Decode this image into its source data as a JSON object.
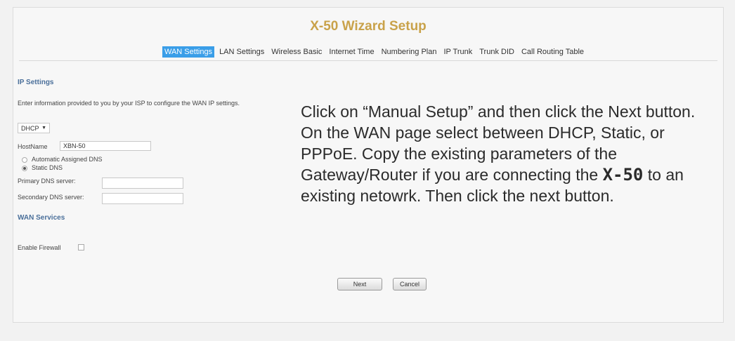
{
  "header": {
    "title": "X-50 Wizard Setup"
  },
  "tabs": [
    {
      "label": "WAN Settings",
      "active": true
    },
    {
      "label": "LAN Settings",
      "active": false
    },
    {
      "label": "Wireless Basic",
      "active": false
    },
    {
      "label": "Internet Time",
      "active": false
    },
    {
      "label": "Numbering Plan",
      "active": false
    },
    {
      "label": "IP Trunk",
      "active": false
    },
    {
      "label": "Trunk DID",
      "active": false
    },
    {
      "label": "Call Routing Table",
      "active": false
    }
  ],
  "ip_settings": {
    "title": "IP Settings",
    "description": "Enter information provided to you by your ISP to configure the WAN IP settings.",
    "mode": "DHCP",
    "hostname_label": "HostName",
    "hostname_value": "XBN-50",
    "dns_auto_label": "Automatic Assigned DNS",
    "dns_static_label": "Static DNS",
    "primary_dns_label": "Primary DNS server:",
    "primary_dns_value": "",
    "secondary_dns_label": "Secondary DNS server:",
    "secondary_dns_value": ""
  },
  "wan_services": {
    "title": "WAN Services",
    "firewall_label": "Enable Firewall",
    "firewall_checked": false
  },
  "instructions": {
    "part1": "Click on “Manual Setup” and then click the Next button. On the WAN page select between DHCP, Static, or PPPoE. Copy the existing parameters of the Gateway/Router if you are connecting  the ",
    "brand": "X-50",
    "part2": " to an existing netowrk. Then click the next button."
  },
  "buttons": {
    "next": "Next",
    "cancel": "Cancel"
  },
  "colors": {
    "title": "#c9a24a",
    "tab_active": "#3a9ee8",
    "section_title": "#4a6f9a"
  }
}
